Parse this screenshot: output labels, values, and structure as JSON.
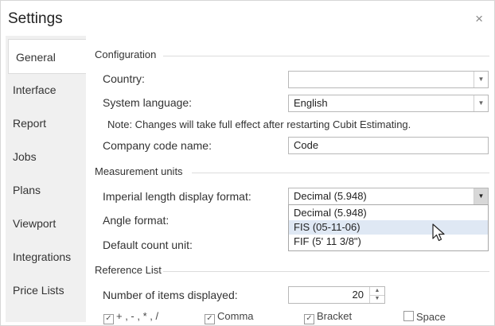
{
  "window": {
    "title": "Settings",
    "close_symbol": "×"
  },
  "sidebar": {
    "items": [
      {
        "label": "General",
        "active": true
      },
      {
        "label": "Interface"
      },
      {
        "label": "Report"
      },
      {
        "label": "Jobs"
      },
      {
        "label": "Plans"
      },
      {
        "label": "Viewport"
      },
      {
        "label": "Integrations"
      },
      {
        "label": "Price Lists"
      }
    ]
  },
  "configuration": {
    "section_title": "Configuration",
    "country_label": "Country:",
    "country_value": "",
    "language_label": "System language:",
    "language_value": "English",
    "note": "Note: Changes will take full effect after restarting Cubit Estimating.",
    "company_code_label": "Company code name:",
    "company_code_value": "Code"
  },
  "measurement": {
    "section_title": "Measurement units",
    "imperial_label": "Imperial length display format:",
    "imperial_value": "Decimal (5.948)",
    "imperial_options": [
      "Decimal (5.948)",
      "FIS (05-11-06)",
      "FIF (5' 11 3/8\")"
    ],
    "angle_label": "Angle format:",
    "count_unit_label": "Default count unit:"
  },
  "reference": {
    "section_title": "Reference List",
    "items_label": "Number of items displayed:",
    "items_value": "20",
    "checkboxes": [
      {
        "label": "+ , - , * , /",
        "checked": true
      },
      {
        "label": "Comma",
        "checked": true
      },
      {
        "label": "Bracket",
        "checked": true
      },
      {
        "label": "Space",
        "checked": false
      }
    ]
  },
  "colors": {
    "sidebar_bg": "#f0f0f0",
    "highlight": "#dfe8f4",
    "border": "#b8b8b8"
  }
}
